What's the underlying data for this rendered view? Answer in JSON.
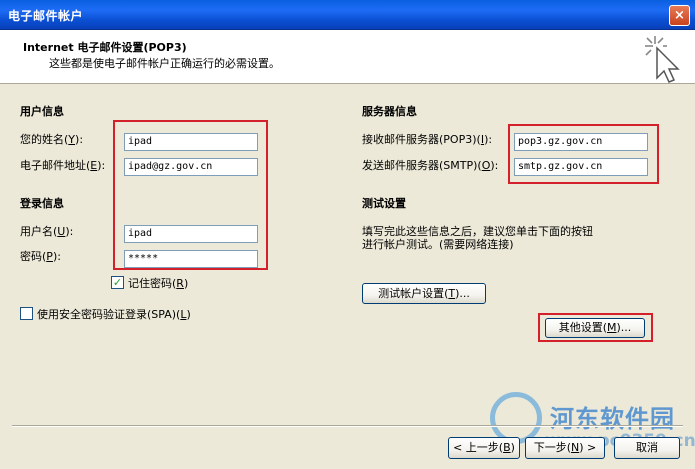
{
  "window": {
    "title": "电子邮件帐户",
    "close_icon": "×"
  },
  "header": {
    "title": "Internet 电子邮件设置(POP3)",
    "subtitle": "这些都是使电子邮件帐户正确运行的必需设置。"
  },
  "user_info": {
    "heading": "用户信息",
    "name_label": "您的姓名",
    "name_key": "Y",
    "email_label": "电子邮件地址",
    "email_key": "E",
    "name_value": "ipad",
    "email_value": "ipad@gz.gov.cn"
  },
  "login_info": {
    "heading": "登录信息",
    "user_label": "用户名",
    "user_key": "U",
    "password_label": "密码",
    "password_key": "P",
    "user_value": "ipad",
    "password_value": "*****",
    "remember_label": "记住密码",
    "remember_key": "R",
    "remember_check": "✓",
    "spa_label": "使用安全密码验证登录(SPA)",
    "spa_key": "L"
  },
  "server_info": {
    "heading": "服务器信息",
    "incoming_label": "接收邮件服务器(POP3)",
    "incoming_key": "I",
    "outgoing_label": "发送邮件服务器(SMTP)",
    "outgoing_key": "O",
    "incoming_value": "pop3.gz.gov.cn",
    "outgoing_value": "smtp.gz.gov.cn"
  },
  "test": {
    "heading": "测试设置",
    "desc_line1": "填写完此这些信息之后，建议您单击下面的按钮",
    "desc_line2": "进行帐户测试。(需要网络连接)",
    "test_button": "测试帐户设置",
    "test_key": "T",
    "more_button": "其他设置",
    "more_key": "M"
  },
  "footer": {
    "back": "< 上一步",
    "back_key": "B",
    "next": "下一步",
    "next_key": "N",
    "cancel": "取消"
  },
  "watermark": {
    "text": "河东软件园",
    "url": "www.pc0359.cn"
  },
  "colors": {
    "title_bar": "#0a5fe0",
    "highlight": "#d4202a",
    "dialog_bg": "#ece9d8"
  }
}
